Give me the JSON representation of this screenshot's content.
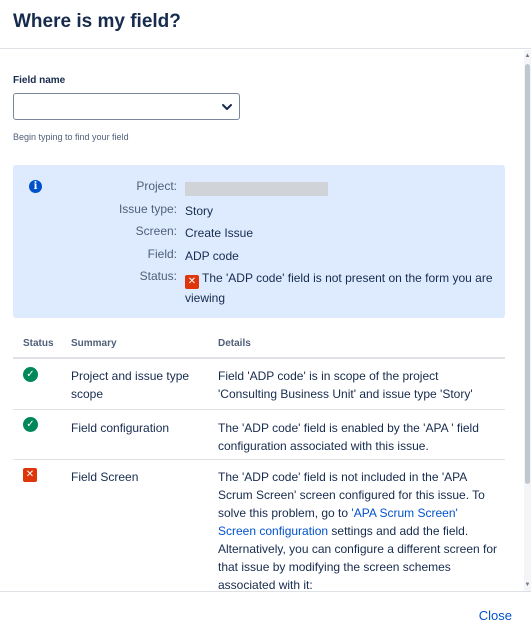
{
  "dialog": {
    "title": "Where is my field?",
    "field_label": "Field name",
    "field_value": "",
    "helper_text": "Begin typing to find your field",
    "close_label": "Close"
  },
  "info": {
    "project_label": "Project:",
    "project_value": "",
    "issue_type_label": "Issue type:",
    "issue_type_value": "Story",
    "screen_label": "Screen:",
    "screen_value": "Create Issue",
    "field_label": "Field:",
    "field_value": "ADP code",
    "status_label": "Status:",
    "status_value": "The 'ADP code' field is not present on the form you are viewing"
  },
  "table": {
    "headers": {
      "status": "Status",
      "summary": "Summary",
      "details": "Details"
    },
    "rows": [
      {
        "status": "ok",
        "summary": "Project and issue type scope",
        "details": "Field 'ADP code' is in scope of the project 'Consulting Business Unit' and issue type 'Story'"
      },
      {
        "status": "ok",
        "summary": "Field configuration",
        "details": "The 'ADP code' field is enabled by the 'APA ' field configuration associated with this issue."
      },
      {
        "status": "error",
        "summary": "Field Screen",
        "details_intro": "The 'ADP code' field is not included in the 'APA Scrum Screen' screen configured for this issue. To solve this problem, go to ",
        "details_link": "'APA Scrum Screen' Screen configuration",
        "details_outro": " settings and add the field. Alternatively, you can configure a different screen for that issue by modifying the screen schemes associated with it:"
      }
    ]
  },
  "colors": {
    "ok": "#00875a",
    "error": "#de350b",
    "info_bg": "#deebff",
    "link": "#0052cc"
  }
}
